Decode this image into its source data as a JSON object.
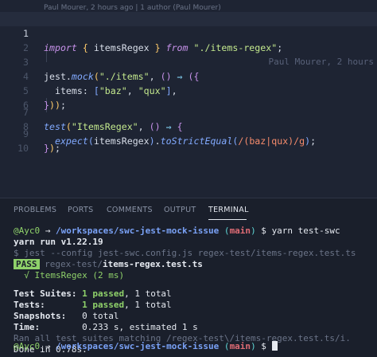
{
  "editor": {
    "blame_header": "Paul Mourer, 2 hours ago | 1 author (Paul Mourer)",
    "inline_blame": "Paul Mourer, 2 hours",
    "line_numbers": [
      "1",
      "2",
      "3",
      "4",
      "5",
      "6",
      "7",
      "8",
      "9",
      "10"
    ],
    "tokens": {
      "l1_import": "import",
      "l1_open": "{",
      "l1_name": " itemsRegex ",
      "l1_close": "}",
      "l1_from": " from ",
      "l1_path": "\"./items-regex\"",
      "l1_semi": ";",
      "l3_jest": "jest",
      "l3_dot": ".",
      "l3_mock": "mock",
      "l3_paren": "(",
      "l3_path": "\"./items\"",
      "l3_comma": ", ",
      "l3_arrowparens": "()",
      "l3_arrow": " ⇒ ",
      "l3_open": "({",
      "l4_key": "items: ",
      "l4_lbr": "[",
      "l4_baz": "\"baz\"",
      "l4_comma": ", ",
      "l4_qux": "\"qux\"",
      "l4_rbr": "]",
      "l4_tail": ",",
      "l5_close": "}",
      "l5_paren": "))",
      "l5_semi": ";",
      "l7_test": "test",
      "l7_paren": "(",
      "l7_name": "\"ItemsRegex\"",
      "l7_comma": ", ",
      "l7_arrowparens": "()",
      "l7_arrow": " ⇒ ",
      "l7_open": "{",
      "l8_expect": "expect",
      "l8_lp": "(",
      "l8_arg": "itemsRegex",
      "l8_rp": ")",
      "l8_dot": ".",
      "l8_method": "toStrictEqual",
      "l8_lp2": "(",
      "l8_regex": "/(baz|qux)/g",
      "l8_rp2": ")",
      "l8_semi": ";",
      "l9_close": "}",
      "l9_paren": ")",
      "l9_semi": ";"
    }
  },
  "panel": {
    "tabs": [
      "PROBLEMS",
      "PORTS",
      "COMMENTS",
      "OUTPUT",
      "TERMINAL"
    ],
    "active_tab": "TERMINAL"
  },
  "terminal": {
    "prompt_user": "@Ayc0",
    "prompt_arrow": " → ",
    "prompt_path": "/workspaces/swc-jest-mock-issue",
    "prompt_branch_open": " (",
    "prompt_branch": "main",
    "prompt_branch_close": ")",
    "prompt_dollar": " $ ",
    "command": "yarn test-swc",
    "yarn_version": "yarn run v1.22.19",
    "jest_cmd": "$ jest --config jest-swc.config.js regex-test/items-regex.test.ts",
    "pass_badge": "PASS",
    "test_dir": " regex-test/",
    "test_file": "items-regex.test.ts",
    "test_result": "  √ ItemsRegex (2 ms)",
    "suites_label": "Test Suites: ",
    "suites_passed": "1 passed",
    "suites_total": ", 1 total",
    "tests_label": "Tests:       ",
    "tests_passed": "1 passed",
    "tests_total": ", 1 total",
    "snapshots_label": "Snapshots:   ",
    "snapshots_value": "0 total",
    "time_label": "Time:        ",
    "time_value": "0.233 s, estimated 1 s",
    "ran_all": "Ran all test suites matching /regex-test\\/items-regex.test.ts/i.",
    "done": "Done in 0.78s."
  }
}
